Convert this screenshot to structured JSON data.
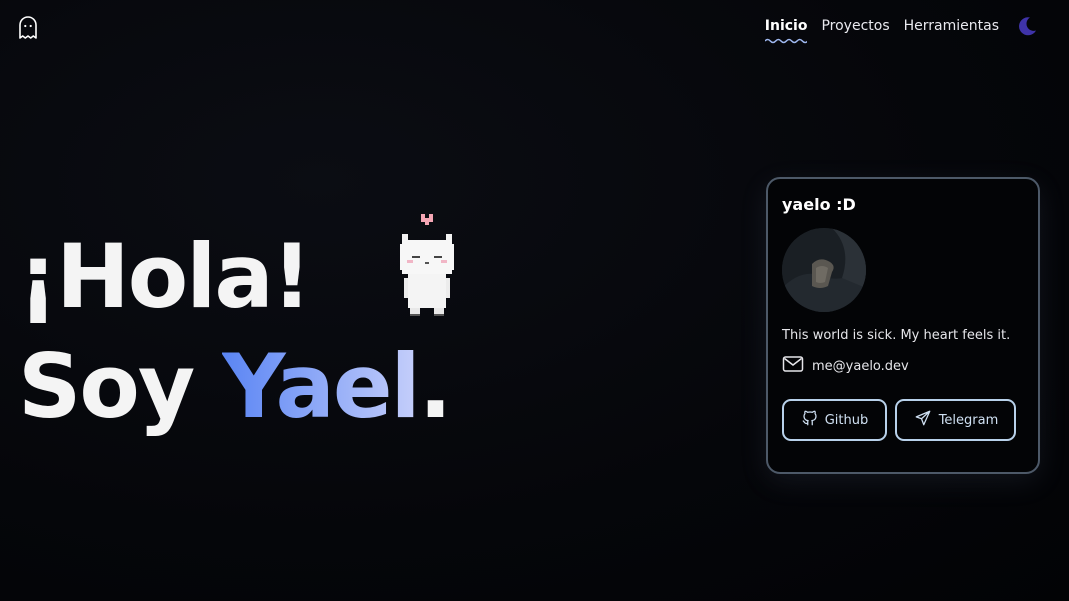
{
  "header": {
    "logo_icon": "ghost-icon",
    "nav": [
      {
        "label": "Inicio",
        "active": true
      },
      {
        "label": "Proyectos",
        "active": false
      },
      {
        "label": "Herramientas",
        "active": false
      }
    ],
    "theme_icon": "moon-icon",
    "accent": "#5b4bd0"
  },
  "hero": {
    "line1": "¡Hola!",
    "line2_prefix": "Soy ",
    "line2_name": "Yael",
    "line2_suffix": ".",
    "name_gradient": [
      "#5a85f4",
      "#c6cffb"
    ],
    "mascot_icon": "pixel-cat-icon"
  },
  "card": {
    "title": "yaelo :D",
    "bio": "This world is sick. My heart feels it.",
    "email": "me@yaelo.dev",
    "email_icon": "mail-icon",
    "buttons": [
      {
        "label": "Github",
        "icon": "github-icon"
      },
      {
        "label": "Telegram",
        "icon": "send-icon"
      }
    ],
    "border_color": "#4d5968",
    "button_color": "#b8d1ea"
  }
}
